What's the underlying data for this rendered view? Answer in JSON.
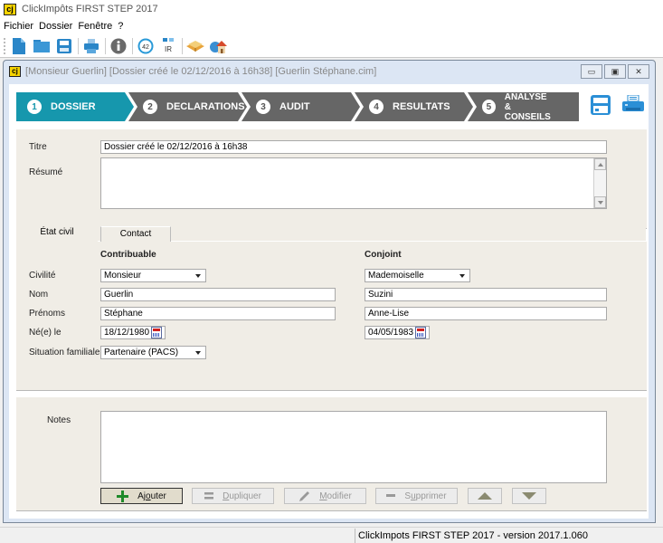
{
  "app": {
    "title": "ClickImpôts FIRST STEP 2017",
    "logo_text": "cj"
  },
  "menu": [
    "Fichier",
    "Dossier",
    "Fenêtre",
    "?"
  ],
  "toolbar": {
    "items": [
      "new-document-icon",
      "open-folder-icon",
      "save-icon",
      "print-icon",
      "info-icon",
      "form-42-icon",
      "ir-icon",
      "book-icon",
      "home-icon"
    ],
    "badge_42": "42",
    "badge_ir": "IR"
  },
  "document_window": {
    "title": "[Monsieur Guerlin] [Dossier créé le 02/12/2016 à 16h38] [Guerlin Stéphane.cim]",
    "buttons": {
      "minimize": "▭",
      "maximize": "▣",
      "close": "✕"
    }
  },
  "steps": [
    {
      "num": "1",
      "label": "DOSSIER",
      "active": true
    },
    {
      "num": "2",
      "label": "DECLARATIONS",
      "active": false
    },
    {
      "num": "3",
      "label": "AUDIT",
      "active": false
    },
    {
      "num": "4",
      "label": "RESULTATS",
      "active": false
    },
    {
      "num": "5",
      "label_line1": "ANALYSE &",
      "label_line2": "CONSEILS",
      "active": false
    }
  ],
  "colors": {
    "step_active": "#1697ad",
    "step_inactive": "#666666",
    "panel_bg": "#f0ede6",
    "accent_blue": "#2b8fd6"
  },
  "header_form": {
    "titre_label": "Titre",
    "titre_value": "Dossier créé le 02/12/2016 à 16h38",
    "resume_label": "Résumé",
    "resume_value": ""
  },
  "tabs": [
    {
      "label": "État civil",
      "active": true
    },
    {
      "label": "Contact",
      "active": false
    }
  ],
  "etat_civil": {
    "col_contribuable": "Contribuable",
    "col_conjoint": "Conjoint",
    "labels": {
      "civilite": "Civilité",
      "nom": "Nom",
      "prenoms": "Prénoms",
      "ne_le": "Né(e) le",
      "situation": "Situation familiale"
    },
    "contribuable": {
      "civilite": "Monsieur",
      "nom": "Guerlin",
      "prenoms": "Stéphane",
      "ne_le": "18/12/1980",
      "situation": "Partenaire (PACS)"
    },
    "conjoint": {
      "civilite": "Mademoiselle",
      "nom": "Suzini",
      "prenoms": "Anne-Lise",
      "ne_le": "04/05/1983"
    }
  },
  "notes": {
    "label": "Notes",
    "value": "",
    "buttons": {
      "ajouter_pre": "Aj",
      "ajouter_ul": "o",
      "ajouter_post": "uter",
      "dupliquer_ul": "D",
      "dupliquer_post": "upliquer",
      "modifier_ul": "M",
      "modifier_post": "odifier",
      "supprimer_pre": "S",
      "supprimer_ul": "u",
      "supprimer_post": "pprimer"
    }
  },
  "status": {
    "version_text": "ClickImpots FIRST STEP 2017 - version 2017.1.060"
  }
}
